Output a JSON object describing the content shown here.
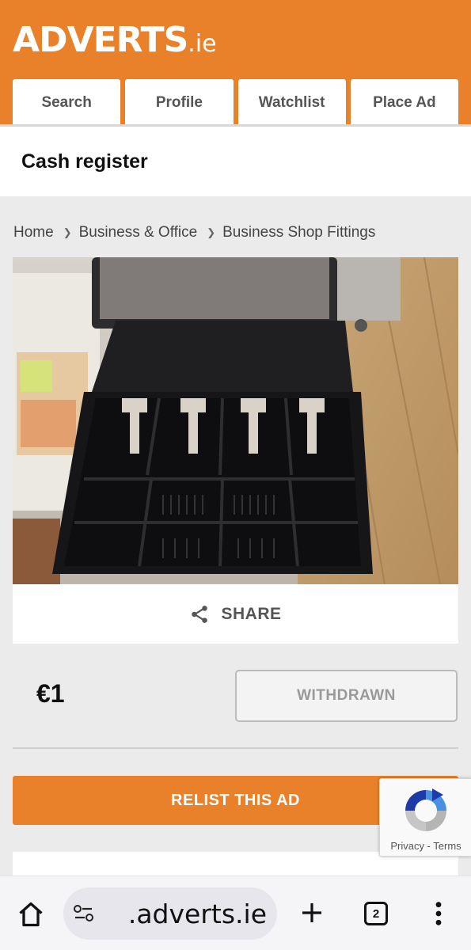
{
  "header": {
    "logo_main": "ADVERTS",
    "logo_tld": ".ie",
    "nav": [
      {
        "label": "Search"
      },
      {
        "label": "Profile"
      },
      {
        "label": "Watchlist"
      },
      {
        "label": "Place Ad"
      }
    ],
    "brand_color": "#e8812a"
  },
  "ad": {
    "title": "Cash register",
    "breadcrumb": [
      "Home",
      "Business & Office",
      "Business Shop Fittings"
    ],
    "image_description_icon": "photo",
    "share_label": "SHARE",
    "share_icon": "share-icon",
    "price": "€1",
    "status_button": "WITHDRAWN",
    "relist_button": "RELIST THIS AD"
  },
  "recaptcha": {
    "links": "Privacy - Terms"
  },
  "browser": {
    "url": ".adverts.ie",
    "tab_count": "2",
    "icons": [
      "home-icon",
      "site-settings-icon",
      "new-tab-icon",
      "tab-switcher-icon",
      "menu-icon"
    ]
  }
}
